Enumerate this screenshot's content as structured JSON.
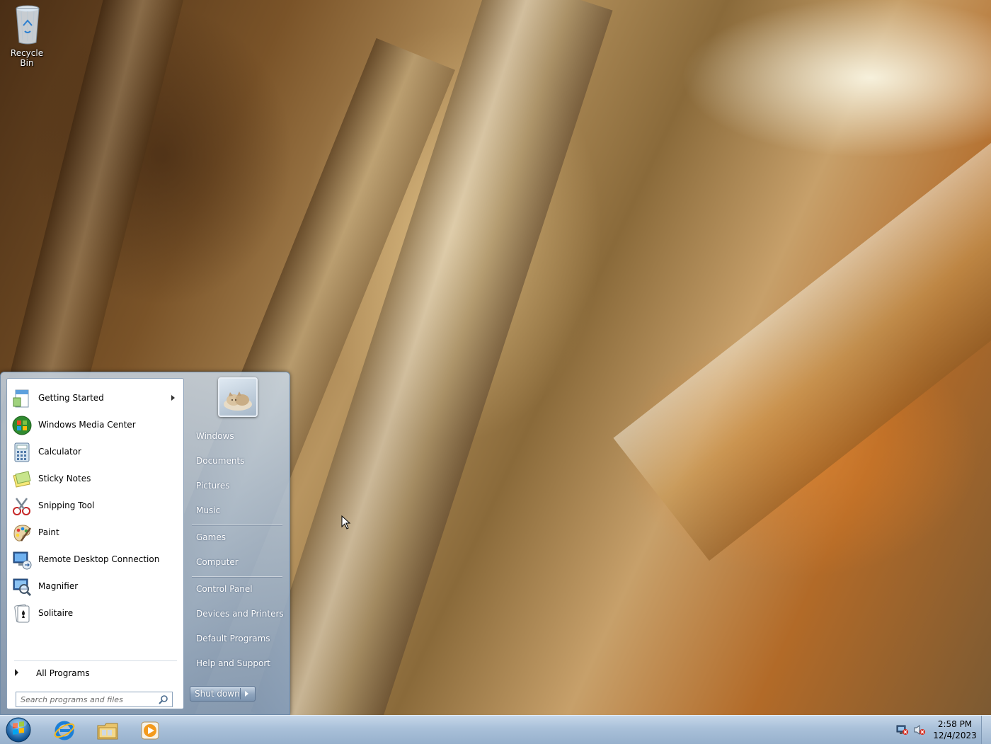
{
  "desktop": {
    "icons": [
      {
        "label": "Recycle Bin",
        "icon": "recycle-bin-icon"
      }
    ]
  },
  "start_menu": {
    "programs": [
      {
        "label": "Getting Started",
        "icon": "getting-started-icon",
        "has_submenu": true
      },
      {
        "label": "Windows Media Center",
        "icon": "windows-media-center-icon"
      },
      {
        "label": "Calculator",
        "icon": "calculator-icon"
      },
      {
        "label": "Sticky Notes",
        "icon": "sticky-notes-icon"
      },
      {
        "label": "Snipping Tool",
        "icon": "snipping-tool-icon"
      },
      {
        "label": "Paint",
        "icon": "paint-icon"
      },
      {
        "label": "Remote Desktop Connection",
        "icon": "remote-desktop-icon"
      },
      {
        "label": "Magnifier",
        "icon": "magnifier-icon"
      },
      {
        "label": "Solitaire",
        "icon": "solitaire-icon"
      }
    ],
    "all_programs_label": "All Programs",
    "search_placeholder": "Search programs and files",
    "right_pane": {
      "items": [
        {
          "label": "Windows"
        },
        {
          "label": "Documents"
        },
        {
          "label": "Pictures"
        },
        {
          "label": "Music"
        },
        {
          "label": "Games"
        },
        {
          "label": "Computer"
        },
        {
          "label": "Control Panel"
        },
        {
          "label": "Devices and Printers"
        },
        {
          "label": "Default Programs"
        },
        {
          "label": "Help and Support"
        }
      ]
    },
    "shutdown_label": "Shut down"
  },
  "taskbar": {
    "pinned": [
      {
        "icon": "internet-explorer-icon"
      },
      {
        "icon": "windows-explorer-icon"
      },
      {
        "icon": "windows-media-player-icon"
      }
    ],
    "tray": [
      {
        "icon": "network-disconnected-icon"
      },
      {
        "icon": "volume-muted-icon"
      }
    ],
    "clock": {
      "time": "2:58 PM",
      "date": "12/4/2023"
    }
  }
}
